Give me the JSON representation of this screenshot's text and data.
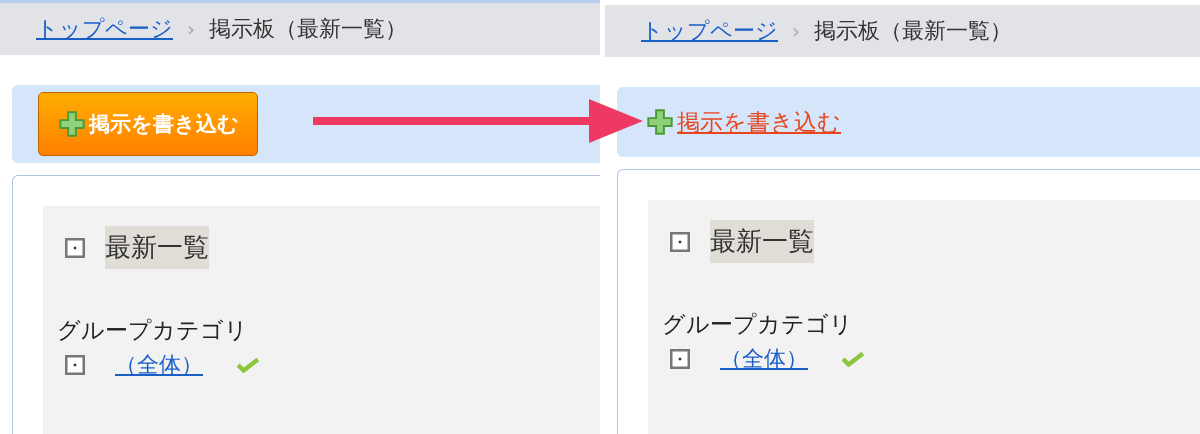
{
  "panels": [
    {
      "breadcrumb": {
        "home": "トップページ",
        "separator": "›",
        "current": "掲示板（最新一覧）"
      },
      "post_action": {
        "kind": "button",
        "label": "掲示を書き込む"
      },
      "section": {
        "title": "最新一覧",
        "category_label": "グループカテゴリ",
        "categories": [
          {
            "label": "（全体）",
            "checked": true
          }
        ]
      }
    },
    {
      "breadcrumb": {
        "home": "トップページ",
        "separator": "›",
        "current": "掲示板（最新一覧）"
      },
      "post_action": {
        "kind": "link",
        "label": "掲示を書き込む"
      },
      "section": {
        "title": "最新一覧",
        "category_label": "グループカテゴリ",
        "categories": [
          {
            "label": "（全体）",
            "checked": true
          }
        ]
      }
    }
  ]
}
